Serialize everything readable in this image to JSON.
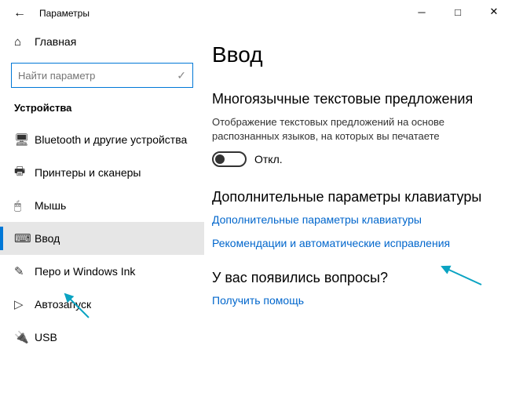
{
  "window": {
    "title": "Параметры"
  },
  "sidebar": {
    "home": "Главная",
    "search_placeholder": "Найти параметр",
    "category": "Устройства",
    "items": [
      {
        "label": "Bluetooth и другие устройства"
      },
      {
        "label": "Принтеры и сканеры"
      },
      {
        "label": "Мышь"
      },
      {
        "label": "Ввод"
      },
      {
        "label": "Перо и Windows Ink"
      },
      {
        "label": "Автозапуск"
      },
      {
        "label": "USB"
      }
    ]
  },
  "main": {
    "heading": "Ввод",
    "multilang": {
      "title": "Многоязычные текстовые предложения",
      "desc": "Отображение текстовых предложений на основе распознанных языков, на которых вы печатаете",
      "toggle_state": "Откл."
    },
    "keyboard": {
      "title": "Дополнительные параметры клавиатуры",
      "link1": "Дополнительные параметры клавиатуры",
      "link2": "Рекомендации и автоматические исправления"
    },
    "help": {
      "title": "У вас появились вопросы?",
      "link": "Получить помощь"
    }
  }
}
